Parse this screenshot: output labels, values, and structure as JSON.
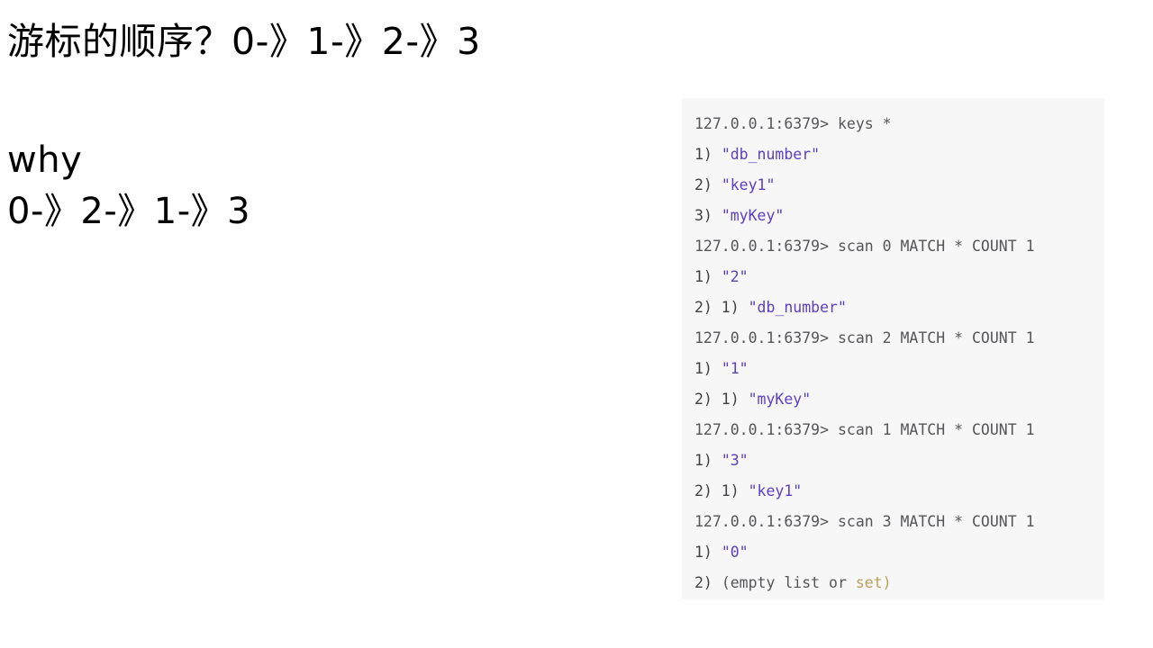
{
  "slide": {
    "heading": "游标的顺序？0-》1-》2-》3",
    "why_label": "why",
    "sequence": "0-》2-》1-》3"
  },
  "terminal": {
    "panel_background": "#f7f7f7",
    "colors": {
      "prompt": "#56565a",
      "index": "#3f3f44",
      "string": "#5b3fc4",
      "keyword": "#b9a15c"
    },
    "lines": [
      {
        "id": "line-1",
        "type": "command",
        "segments": [
          {
            "cls": "tok-prompt",
            "text": "127.0.0.1:6379> "
          },
          {
            "cls": "tok-command",
            "text": "keys *"
          }
        ]
      },
      {
        "id": "line-2",
        "type": "result",
        "segments": [
          {
            "cls": "tok-index",
            "text": "1) "
          },
          {
            "cls": "tok-string",
            "text": "\"db_number\""
          }
        ]
      },
      {
        "id": "line-3",
        "type": "result",
        "segments": [
          {
            "cls": "tok-index",
            "text": "2) "
          },
          {
            "cls": "tok-string",
            "text": "\"key1\""
          }
        ]
      },
      {
        "id": "line-4",
        "type": "result",
        "segments": [
          {
            "cls": "tok-index",
            "text": "3) "
          },
          {
            "cls": "tok-string",
            "text": "\"myKey\""
          }
        ]
      },
      {
        "id": "line-5",
        "type": "command",
        "segments": [
          {
            "cls": "tok-prompt",
            "text": "127.0.0.1:6379> "
          },
          {
            "cls": "tok-command",
            "text": "scan 0 MATCH * COUNT 1"
          }
        ]
      },
      {
        "id": "line-6",
        "type": "result",
        "segments": [
          {
            "cls": "tok-index",
            "text": "1) "
          },
          {
            "cls": "tok-string",
            "text": "\"2\""
          }
        ]
      },
      {
        "id": "line-7",
        "type": "result",
        "segments": [
          {
            "cls": "tok-index",
            "text": "2) 1) "
          },
          {
            "cls": "tok-string",
            "text": "\"db_number\""
          }
        ]
      },
      {
        "id": "line-8",
        "type": "command",
        "segments": [
          {
            "cls": "tok-prompt",
            "text": "127.0.0.1:6379> "
          },
          {
            "cls": "tok-command",
            "text": "scan 2 MATCH * COUNT 1"
          }
        ]
      },
      {
        "id": "line-9",
        "type": "result",
        "segments": [
          {
            "cls": "tok-index",
            "text": "1) "
          },
          {
            "cls": "tok-string",
            "text": "\"1\""
          }
        ]
      },
      {
        "id": "line-10",
        "type": "result",
        "segments": [
          {
            "cls": "tok-index",
            "text": "2) 1) "
          },
          {
            "cls": "tok-string",
            "text": "\"myKey\""
          }
        ]
      },
      {
        "id": "line-11",
        "type": "command",
        "segments": [
          {
            "cls": "tok-prompt",
            "text": "127.0.0.1:6379> "
          },
          {
            "cls": "tok-command",
            "text": "scan 1 MATCH * COUNT 1"
          }
        ]
      },
      {
        "id": "line-12",
        "type": "result",
        "segments": [
          {
            "cls": "tok-index",
            "text": "1) "
          },
          {
            "cls": "tok-string",
            "text": "\"3\""
          }
        ]
      },
      {
        "id": "line-13",
        "type": "result",
        "segments": [
          {
            "cls": "tok-index",
            "text": "2) 1) "
          },
          {
            "cls": "tok-string",
            "text": "\"key1\""
          }
        ]
      },
      {
        "id": "line-14",
        "type": "command",
        "segments": [
          {
            "cls": "tok-prompt",
            "text": "127.0.0.1:6379> "
          },
          {
            "cls": "tok-command",
            "text": "scan 3 MATCH * COUNT 1"
          }
        ]
      },
      {
        "id": "line-15",
        "type": "result",
        "segments": [
          {
            "cls": "tok-index",
            "text": "1) "
          },
          {
            "cls": "tok-string",
            "text": "\"0\""
          }
        ]
      },
      {
        "id": "line-16",
        "type": "result",
        "segments": [
          {
            "cls": "tok-index",
            "text": "2) "
          },
          {
            "cls": "tok-plain",
            "text": "(empty list or "
          },
          {
            "cls": "tok-keyword",
            "text": "set)"
          }
        ]
      }
    ]
  }
}
